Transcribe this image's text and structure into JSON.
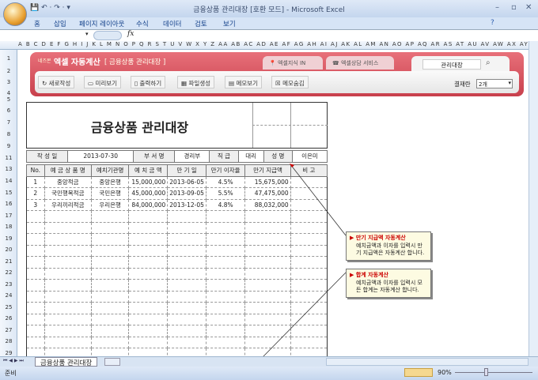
{
  "window": {
    "title": "금융상품 관리대장  [호환 모드] - Microsoft Excel"
  },
  "ribbon_tabs": [
    "홈",
    "삽입",
    "페이지 레이아웃",
    "수식",
    "데이터",
    "검토",
    "보기"
  ],
  "formula_bar": {
    "fx": "fx"
  },
  "columns": "A B C D E F G H I J K L M N O P Q R S T U V W X Y Z AA AB AC AD AE AF AG AH AI AJ AK AL AM AN AO AP AQ AR AS AT AU AV AW AX AY AZ BB BC",
  "rows": [
    "1",
    "2",
    "3",
    "4",
    "5",
    "6",
    "7",
    "8",
    "9",
    "11",
    "13",
    "14",
    "15",
    "16",
    "17",
    "18",
    "19",
    "20",
    "21",
    "22",
    "23",
    "24",
    "25",
    "26",
    "27",
    "28",
    "29"
  ],
  "banner": {
    "brand": "네즈몬",
    "app": "엑셀 자동계산",
    "subtitle": "[ 금융상품 관리대장 ]",
    "tab1": "엑셀지식 IN",
    "tab2": "엑셀상담 서비스",
    "search_value": "관리대장",
    "buttons": [
      "새로작성",
      "미리보기",
      "출력하기",
      "파일생성",
      "메모보기",
      "메모숨김"
    ],
    "approval_label": "결재란",
    "approval_value": "2개"
  },
  "doc": {
    "title": "금융상품 관리대장",
    "info": [
      {
        "label": "작 성 일",
        "value": "2013-07-30"
      },
      {
        "label": "부 서 명",
        "value": "경리부"
      },
      {
        "label": "직  급",
        "value": "대리"
      },
      {
        "label": "성  명",
        "value": "이은미"
      }
    ],
    "headers": [
      "No.",
      "예 금 상 품 명",
      "예치기관명",
      "예 치 금 액",
      "만 기 일",
      "만기 이자율",
      "만기 지급액",
      "비  고"
    ],
    "rows": [
      [
        "1",
        "중앙적금",
        "중앙은행",
        "15,000,000",
        "2013-06-05",
        "4.5%",
        "15,675,000",
        ""
      ],
      [
        "2",
        "국민행복적금",
        "국민은행",
        "45,000,000",
        "2013-09-05",
        "5.5%",
        "47,475,000",
        ""
      ],
      [
        "3",
        "우리끼리적금",
        "우리은행",
        "84,000,000",
        "2013-12-05",
        "4.8%",
        "88,032,000",
        ""
      ]
    ]
  },
  "notes": [
    {
      "title": "▶ 만기 지급액 자동계산",
      "body": "예치금액과 이자를 입력시 만기 지급액은 자동계산 합니다."
    },
    {
      "title": "▶ 합계 자동계산",
      "body": "예치금액과 이자를 입력시 모든 합계는 자동계산 합니다."
    }
  ],
  "sheet_tab": "금융상품 관리대장",
  "status": {
    "ready": "준비",
    "zoom": "90%"
  }
}
